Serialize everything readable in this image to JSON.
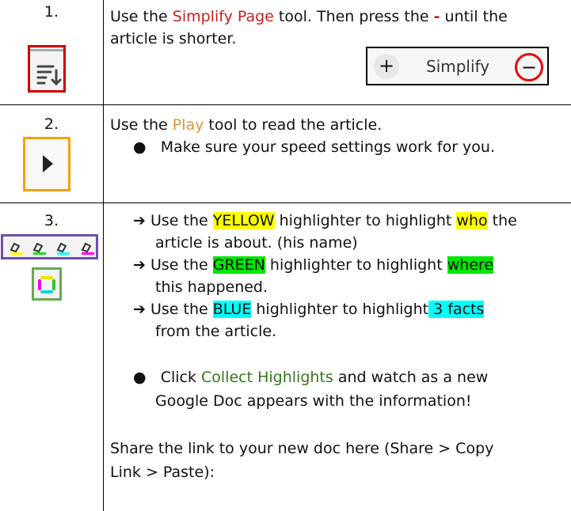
{
  "rows": [
    {
      "number": "1.",
      "icon": "simplify-page-icon",
      "text_pre": "Use the ",
      "tool": "Simplify Page",
      "text_mid": " tool. Then press the ",
      "minus": "-",
      "text_post": " until the",
      "line2": "article is shorter.",
      "widget": {
        "plus": "+",
        "label": "Simplify",
        "minus": "−"
      }
    },
    {
      "number": "2.",
      "icon": "play-icon",
      "text_pre": "Use the ",
      "tool": "Play",
      "text_post": " tool to read the article.",
      "bullet": "Make sure your speed settings work for you."
    },
    {
      "number": "3.",
      "icons": [
        "yellow-highlighter-icon",
        "green-highlighter-icon",
        "blue-highlighter-icon",
        "pink-highlighter-icon",
        "collect-highlights-icon"
      ],
      "items": [
        {
          "pre": "Use the ",
          "hl": "YELLOW",
          "mid": " highlighter to highlight ",
          "hl2": "who",
          "post": " the",
          "line2": "article is about. (his name)"
        },
        {
          "pre": "Use the ",
          "hl": "GREEN",
          "mid": " highlighter to highlight ",
          "hl2": "where",
          "line2": "this happened."
        },
        {
          "pre": "Use the ",
          "hl": "BLUE",
          "mid": " highlighter to  highlight",
          "hl2": " 3 facts",
          "line2": "from the article."
        }
      ],
      "bullet_pre": "Click ",
      "bullet_link": "Collect Highlights",
      "bullet_post": " and watch as a new",
      "bullet_line2": "Google Doc appears with the information!",
      "share_line1": "Share the link to your new doc here (Share > Copy",
      "share_line2": "Link > Paste):"
    }
  ],
  "colors": {
    "red": "#cc1f1f",
    "orange": "#e69138",
    "green": "#38761d",
    "yellow": "#ffff00",
    "hl_green": "#00e600",
    "cyan": "#00ffff",
    "purple": "#6d4fa8"
  }
}
